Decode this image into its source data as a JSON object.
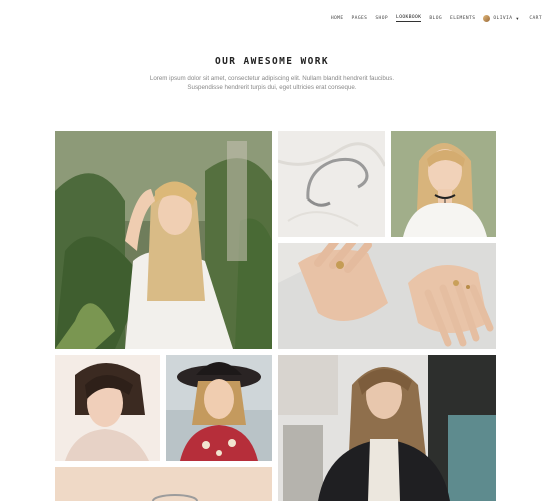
{
  "nav": {
    "items": [
      "HOME",
      "PAGES",
      "SHOP",
      "LOOKBOOK",
      "BLOG",
      "ELEMENTS"
    ],
    "active": "LOOKBOOK",
    "user_name": "OLIVIA",
    "cart_label": "CART"
  },
  "header": {
    "title": "OUR AWESOME WORK",
    "subtitle_line1": "Lorem ipsum dolor sit amet, consectetur adipiscing elit. Nullam blandit hendrerit faucibus.",
    "subtitle_line2": "Suspendisse hendrerit turpis dui, eget ultricies erat conseque."
  },
  "icons": {
    "user": "avatar-icon",
    "dropdown": "chevron-down-icon"
  },
  "colors": {
    "text_dark": "#222222",
    "text_muted": "#888888",
    "background": "#ffffff"
  }
}
